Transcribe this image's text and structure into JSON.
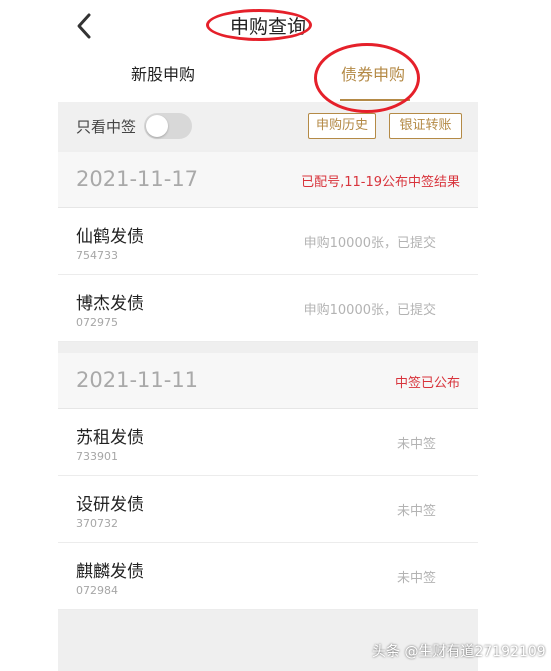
{
  "header": {
    "title": "申购查询",
    "back_icon": "chevron-left-icon"
  },
  "tabs": [
    {
      "label": "新股申购",
      "active": false
    },
    {
      "label": "债券申购",
      "active": true
    }
  ],
  "filter": {
    "toggle_label": "只看中签",
    "toggle_on": false,
    "history_button": "申购历史",
    "transfer_button": "银证转账"
  },
  "groups": [
    {
      "date": "2021-11-17",
      "status": "已配号,11-19公布中签结果",
      "items": [
        {
          "name": "仙鹤发债",
          "code": "754733",
          "status": "申购10000张，已提交"
        },
        {
          "name": "博杰发债",
          "code": "072975",
          "status": "申购10000张，已提交"
        }
      ]
    },
    {
      "date": "2021-11-11",
      "status": "中签已公布",
      "items": [
        {
          "name": "苏租发债",
          "code": "733901",
          "status": "未中签"
        },
        {
          "name": "设研发债",
          "code": "370732",
          "status": "未中签"
        },
        {
          "name": "麒麟发债",
          "code": "072984",
          "status": "未中签"
        }
      ]
    }
  ],
  "watermark": "头条 @生财有道27192109",
  "colors": {
    "accent": "#b48a46",
    "status_red": "#d8343c",
    "annotation_red": "#e5202a"
  }
}
